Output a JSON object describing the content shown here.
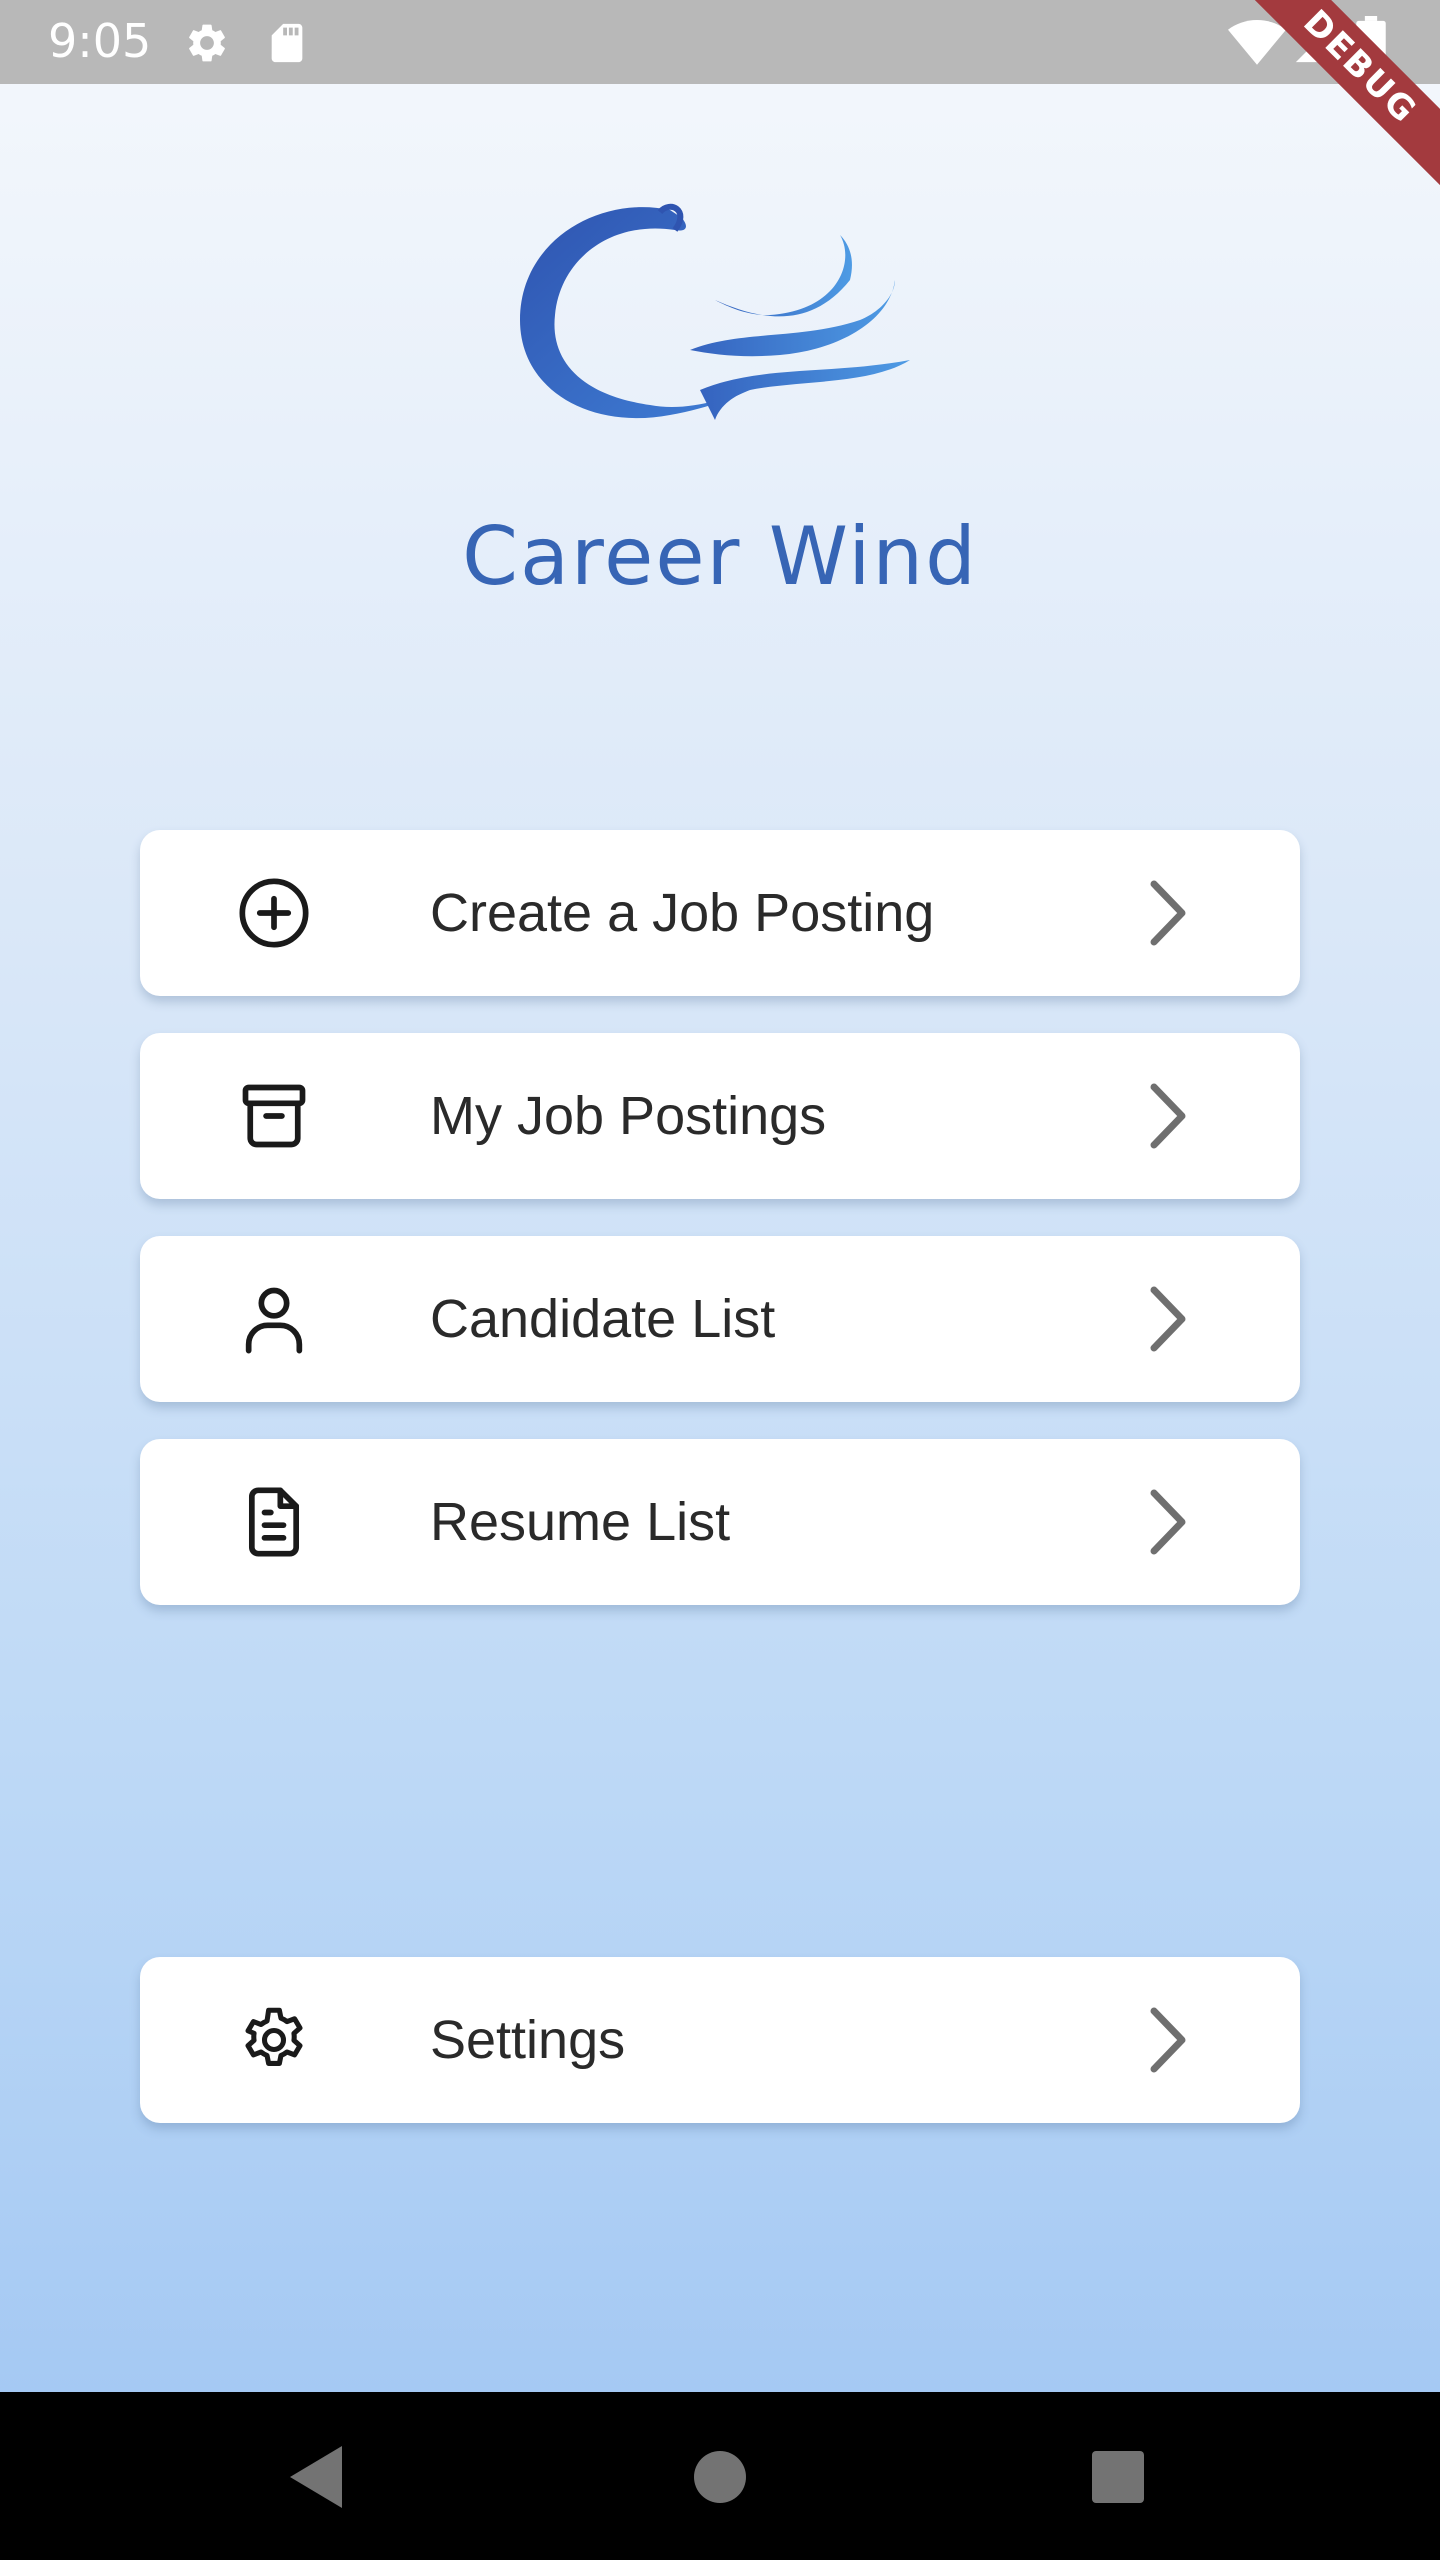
{
  "status_bar": {
    "time": "9:05",
    "icons": [
      "gear-icon",
      "sd-card-icon",
      "wifi-icon",
      "signal-icon",
      "battery-icon"
    ]
  },
  "debug_banner": {
    "label": "DEBUG"
  },
  "app": {
    "title": "Career Wind",
    "brand_color": "#3765b5"
  },
  "menu": {
    "items": [
      {
        "label": "Create a Job Posting",
        "icon": "plus-circle-icon"
      },
      {
        "label": "My Job Postings",
        "icon": "archive-icon"
      },
      {
        "label": "Candidate List",
        "icon": "user-icon"
      },
      {
        "label": "Resume List",
        "icon": "document-icon"
      }
    ],
    "settings": {
      "label": "Settings",
      "icon": "gear-icon"
    }
  },
  "nav_bar": {
    "buttons": [
      "back-icon",
      "home-icon",
      "recents-icon"
    ]
  }
}
